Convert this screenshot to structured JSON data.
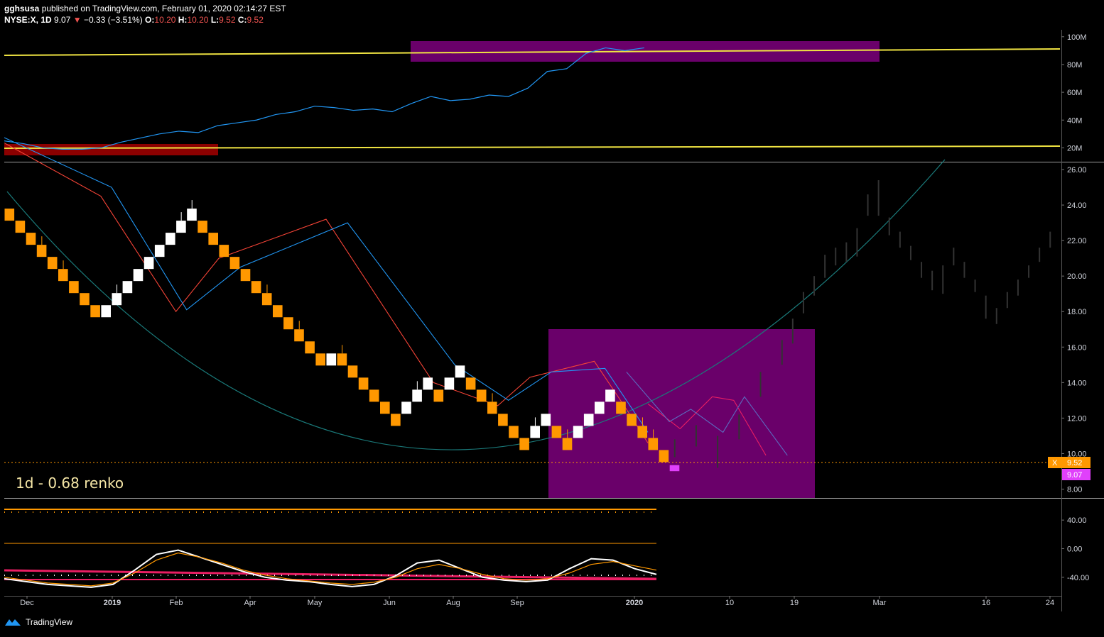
{
  "header": {
    "author": "gghsusa",
    "published": "published on TradingView.com, February 01, 2020 02:14:27 EST",
    "symbol": "NYSE:X, 1D",
    "last": "9.07",
    "change": "−0.33 (−3.51%)",
    "o_label": "O:",
    "o_val": "10.20",
    "h_label": "H:",
    "h_val": "10.20",
    "l_label": "L:",
    "l_val": "9.52",
    "c_label": "C:",
    "c_val": "9.52"
  },
  "annotation": "1d - 0.68 renko",
  "footer": {
    "brand": "TradingView"
  },
  "colors": {
    "up_brick": "#ffffff",
    "down_brick": "#ff9800",
    "last_brick": "#e040fb",
    "fast_ma": "#f44336",
    "slow_ma": "#2196f3",
    "zone_purple": "#6a006a",
    "zone_red": "#8b0000",
    "trendline": "#f0e442",
    "curve": "#1a7a7a"
  },
  "price_badges": {
    "close_marker": "X",
    "close": "9.52",
    "last": "9.07"
  },
  "chart_data": [
    {
      "type": "line",
      "name": "volume-cumulative",
      "y_ticks": [
        "100M",
        "80M",
        "60M",
        "40M",
        "20M"
      ],
      "ylim": [
        10,
        105
      ],
      "series": [
        {
          "values": [
            [
              0,
              25
            ],
            [
              1,
              23
            ],
            [
              2,
              20
            ],
            [
              3,
              19
            ],
            [
              4,
              19
            ],
            [
              5,
              20
            ],
            [
              6,
              24
            ],
            [
              7,
              27
            ],
            [
              8,
              30
            ],
            [
              9,
              32
            ],
            [
              10,
              31
            ],
            [
              11,
              36
            ],
            [
              12,
              38
            ],
            [
              13,
              40
            ],
            [
              14,
              44
            ],
            [
              15,
              46
            ],
            [
              16,
              50
            ],
            [
              17,
              49
            ],
            [
              18,
              47
            ],
            [
              19,
              48
            ],
            [
              20,
              46
            ],
            [
              21,
              52
            ],
            [
              22,
              57
            ],
            [
              23,
              54
            ],
            [
              24,
              55
            ],
            [
              25,
              58
            ],
            [
              26,
              57
            ],
            [
              27,
              63
            ],
            [
              28,
              75
            ],
            [
              29,
              77
            ],
            [
              30,
              88
            ],
            [
              31,
              92
            ],
            [
              32,
              90
            ],
            [
              33,
              92
            ]
          ]
        }
      ]
    },
    {
      "type": "renko",
      "name": "price",
      "y_ticks": [
        "26.00",
        "24.00",
        "22.00",
        "20.00",
        "18.00",
        "16.00",
        "14.00",
        "12.00",
        "10.00",
        "8.00"
      ],
      "ylim": [
        7.5,
        26.4
      ],
      "x_ticks": [
        "Dec",
        "2019",
        "Feb",
        "Apr",
        "May",
        "Jun",
        "Aug",
        "Sep",
        "2020",
        "10",
        "19",
        "Mar",
        "16",
        "24"
      ],
      "brick_size": 0.68,
      "bricks": [
        {
          "d": -1,
          "top": 23.8
        },
        {
          "d": -1,
          "top": 23.12
        },
        {
          "d": -1,
          "top": 22.44
        },
        {
          "d": -1,
          "top": 21.76
        },
        {
          "d": -1,
          "top": 21.08
        },
        {
          "d": -1,
          "top": 20.4
        },
        {
          "d": -1,
          "top": 19.72
        },
        {
          "d": -1,
          "top": 19.04
        },
        {
          "d": -1,
          "top": 18.36
        },
        {
          "d": 1,
          "top": 18.36
        },
        {
          "d": 1,
          "top": 19.04
        },
        {
          "d": 1,
          "top": 19.72
        },
        {
          "d": 1,
          "top": 20.4
        },
        {
          "d": 1,
          "top": 21.08
        },
        {
          "d": 1,
          "top": 21.76
        },
        {
          "d": 1,
          "top": 22.44
        },
        {
          "d": 1,
          "top": 23.12
        },
        {
          "d": 1,
          "top": 23.8
        },
        {
          "d": -1,
          "top": 23.12
        },
        {
          "d": -1,
          "top": 22.44
        },
        {
          "d": -1,
          "top": 21.76
        },
        {
          "d": -1,
          "top": 21.08
        },
        {
          "d": -1,
          "top": 20.4
        },
        {
          "d": -1,
          "top": 19.72
        },
        {
          "d": -1,
          "top": 19.04
        },
        {
          "d": -1,
          "top": 18.36
        },
        {
          "d": -1,
          "top": 17.68
        },
        {
          "d": -1,
          "top": 17.0
        },
        {
          "d": -1,
          "top": 16.32
        },
        {
          "d": -1,
          "top": 15.64
        },
        {
          "d": 1,
          "top": 15.64
        },
        {
          "d": -1,
          "top": 15.64
        },
        {
          "d": -1,
          "top": 14.96
        },
        {
          "d": -1,
          "top": 14.28
        },
        {
          "d": -1,
          "top": 13.6
        },
        {
          "d": -1,
          "top": 12.92
        },
        {
          "d": -1,
          "top": 12.24
        },
        {
          "d": 1,
          "top": 12.92
        },
        {
          "d": 1,
          "top": 13.6
        },
        {
          "d": 1,
          "top": 14.28
        },
        {
          "d": -1,
          "top": 13.6
        },
        {
          "d": 1,
          "top": 14.28
        },
        {
          "d": 1,
          "top": 14.96
        },
        {
          "d": -1,
          "top": 14.28
        },
        {
          "d": -1,
          "top": 13.6
        },
        {
          "d": -1,
          "top": 12.92
        },
        {
          "d": -1,
          "top": 12.24
        },
        {
          "d": -1,
          "top": 11.56
        },
        {
          "d": -1,
          "top": 10.88
        },
        {
          "d": 1,
          "top": 11.56
        },
        {
          "d": 1,
          "top": 12.24
        },
        {
          "d": -1,
          "top": 11.56
        },
        {
          "d": -1,
          "top": 10.88
        },
        {
          "d": 1,
          "top": 11.56
        },
        {
          "d": 1,
          "top": 12.24
        },
        {
          "d": 1,
          "top": 12.92
        },
        {
          "d": 1,
          "top": 13.6
        },
        {
          "d": -1,
          "top": 12.92
        },
        {
          "d": -1,
          "top": 12.24
        },
        {
          "d": -1,
          "top": 11.56
        },
        {
          "d": -1,
          "top": 10.88
        },
        {
          "d": -1,
          "top": 10.2
        },
        {
          "d": 0,
          "top": 9.52
        }
      ],
      "fast_ma": [
        [
          0,
          27.5
        ],
        [
          9,
          24.5
        ],
        [
          16,
          18.0
        ],
        [
          20,
          21.0
        ],
        [
          30,
          23.2
        ],
        [
          40,
          14.0
        ],
        [
          46,
          12.7
        ],
        [
          49,
          14.3
        ],
        [
          55,
          15.2
        ],
        [
          58,
          12.5
        ],
        [
          60,
          10.6
        ]
      ],
      "slow_ma": [
        [
          0,
          27.8
        ],
        [
          10,
          25.0
        ],
        [
          17,
          18.1
        ],
        [
          22,
          20.5
        ],
        [
          32,
          23.0
        ],
        [
          42,
          15.0
        ],
        [
          47,
          13.0
        ],
        [
          51,
          14.6
        ],
        [
          56,
          14.8
        ],
        [
          60,
          11.2
        ]
      ],
      "projection_fast": [
        [
          60,
          12.8
        ],
        [
          63,
          11.4
        ],
        [
          66,
          13.2
        ],
        [
          68,
          13.0
        ],
        [
          71,
          9.9
        ]
      ],
      "projection_slow": [
        [
          58,
          14.6
        ],
        [
          62,
          11.8
        ],
        [
          64,
          12.5
        ],
        [
          67,
          11.2
        ],
        [
          69,
          13.2
        ],
        [
          73,
          9.9
        ]
      ]
    },
    {
      "type": "line",
      "name": "oscillator",
      "y_ticks": [
        "40.00",
        "0.00",
        "-40.00"
      ],
      "ylim": [
        -66,
        60
      ],
      "series": [
        {
          "name": "",
          "values": [
            -42,
            -46,
            -50,
            -52,
            -54,
            -50,
            -30,
            -8,
            -2,
            -12,
            -22,
            -32,
            -40,
            -44,
            -46,
            -50,
            -53,
            -50,
            -38,
            -20,
            -16,
            -28,
            -40,
            -44,
            -46,
            -44,
            -28,
            -14,
            -16,
            -28,
            -36
          ]
        },
        {
          "name": "",
          "values": [
            -40,
            -44,
            -48,
            -50,
            -52,
            -48,
            -34,
            -16,
            -6,
            -12,
            -20,
            -30,
            -37,
            -42,
            -45,
            -48,
            -50,
            -47,
            -40,
            -28,
            -22,
            -28,
            -36,
            -42,
            -44,
            -42,
            -34,
            -22,
            -18,
            -24,
            -30
          ]
        }
      ]
    }
  ]
}
